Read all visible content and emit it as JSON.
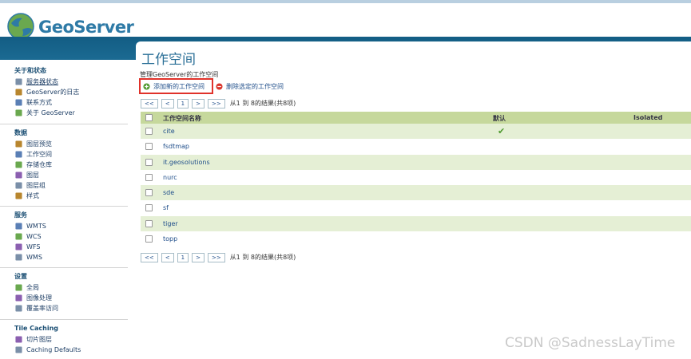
{
  "app": {
    "name": "GeoServer"
  },
  "sidebar": {
    "sections": [
      {
        "title": "关于和状态",
        "items": [
          {
            "label": "服务器状态",
            "icon": "server-status-icon"
          },
          {
            "label": "GeoServer的日志",
            "icon": "log-file-icon"
          },
          {
            "label": "联系方式",
            "icon": "contact-card-icon"
          },
          {
            "label": "关于 GeoServer",
            "icon": "info-icon"
          }
        ]
      },
      {
        "title": "数据",
        "items": [
          {
            "label": "图层预览",
            "icon": "layer-preview-icon"
          },
          {
            "label": "工作空间",
            "icon": "folder-icon"
          },
          {
            "label": "存储仓库",
            "icon": "store-icon"
          },
          {
            "label": "图层",
            "icon": "layer-icon"
          },
          {
            "label": "图层组",
            "icon": "layer-group-icon"
          },
          {
            "label": "样式",
            "icon": "style-palette-icon"
          }
        ]
      },
      {
        "title": "服务",
        "items": [
          {
            "label": "WMTS",
            "icon": "service-icon"
          },
          {
            "label": "WCS",
            "icon": "service-icon"
          },
          {
            "label": "WFS",
            "icon": "service-icon"
          },
          {
            "label": "WMS",
            "icon": "service-icon"
          }
        ]
      },
      {
        "title": "设置",
        "items": [
          {
            "label": "全局",
            "icon": "global-settings-icon"
          },
          {
            "label": "图像处理",
            "icon": "image-processing-icon"
          },
          {
            "label": "覆盖率访问",
            "icon": "coverage-access-icon"
          }
        ]
      },
      {
        "title": "Tile Caching",
        "items": [
          {
            "label": "切片图层",
            "icon": "tile-layers-icon"
          },
          {
            "label": "Caching Defaults",
            "icon": "caching-defaults-icon"
          }
        ]
      }
    ]
  },
  "main": {
    "title": "工作空间",
    "description": "管理GeoServer的工作空间",
    "actions": {
      "add": "添加新的工作空间",
      "remove": "删除选定的工作空间"
    },
    "pager": {
      "first": "<<",
      "prev": "<",
      "page": "1",
      "next": ">",
      "last": ">>",
      "info": "从1 到 8的结果(共8项)"
    },
    "table": {
      "columns": {
        "name": "工作空间名称",
        "default": "默认",
        "isolated": "Isolated"
      },
      "rows": [
        {
          "name": "cite",
          "default": true
        },
        {
          "name": "fsdtmap",
          "default": false
        },
        {
          "name": "it.geosolutions",
          "default": false
        },
        {
          "name": "nurc",
          "default": false
        },
        {
          "name": "sde",
          "default": false
        },
        {
          "name": "sf",
          "default": false
        },
        {
          "name": "tiger",
          "default": false
        },
        {
          "name": "topp",
          "default": false
        }
      ],
      "default_mark": "✔"
    }
  },
  "watermark": "CSDN @SadnessLayTime",
  "colors": {
    "brand_band": "#135d84",
    "row_alt": "#e5efd5",
    "header_row": "#c6d89c",
    "link": "#1f4e8a",
    "highlight_box": "#e0322a"
  }
}
